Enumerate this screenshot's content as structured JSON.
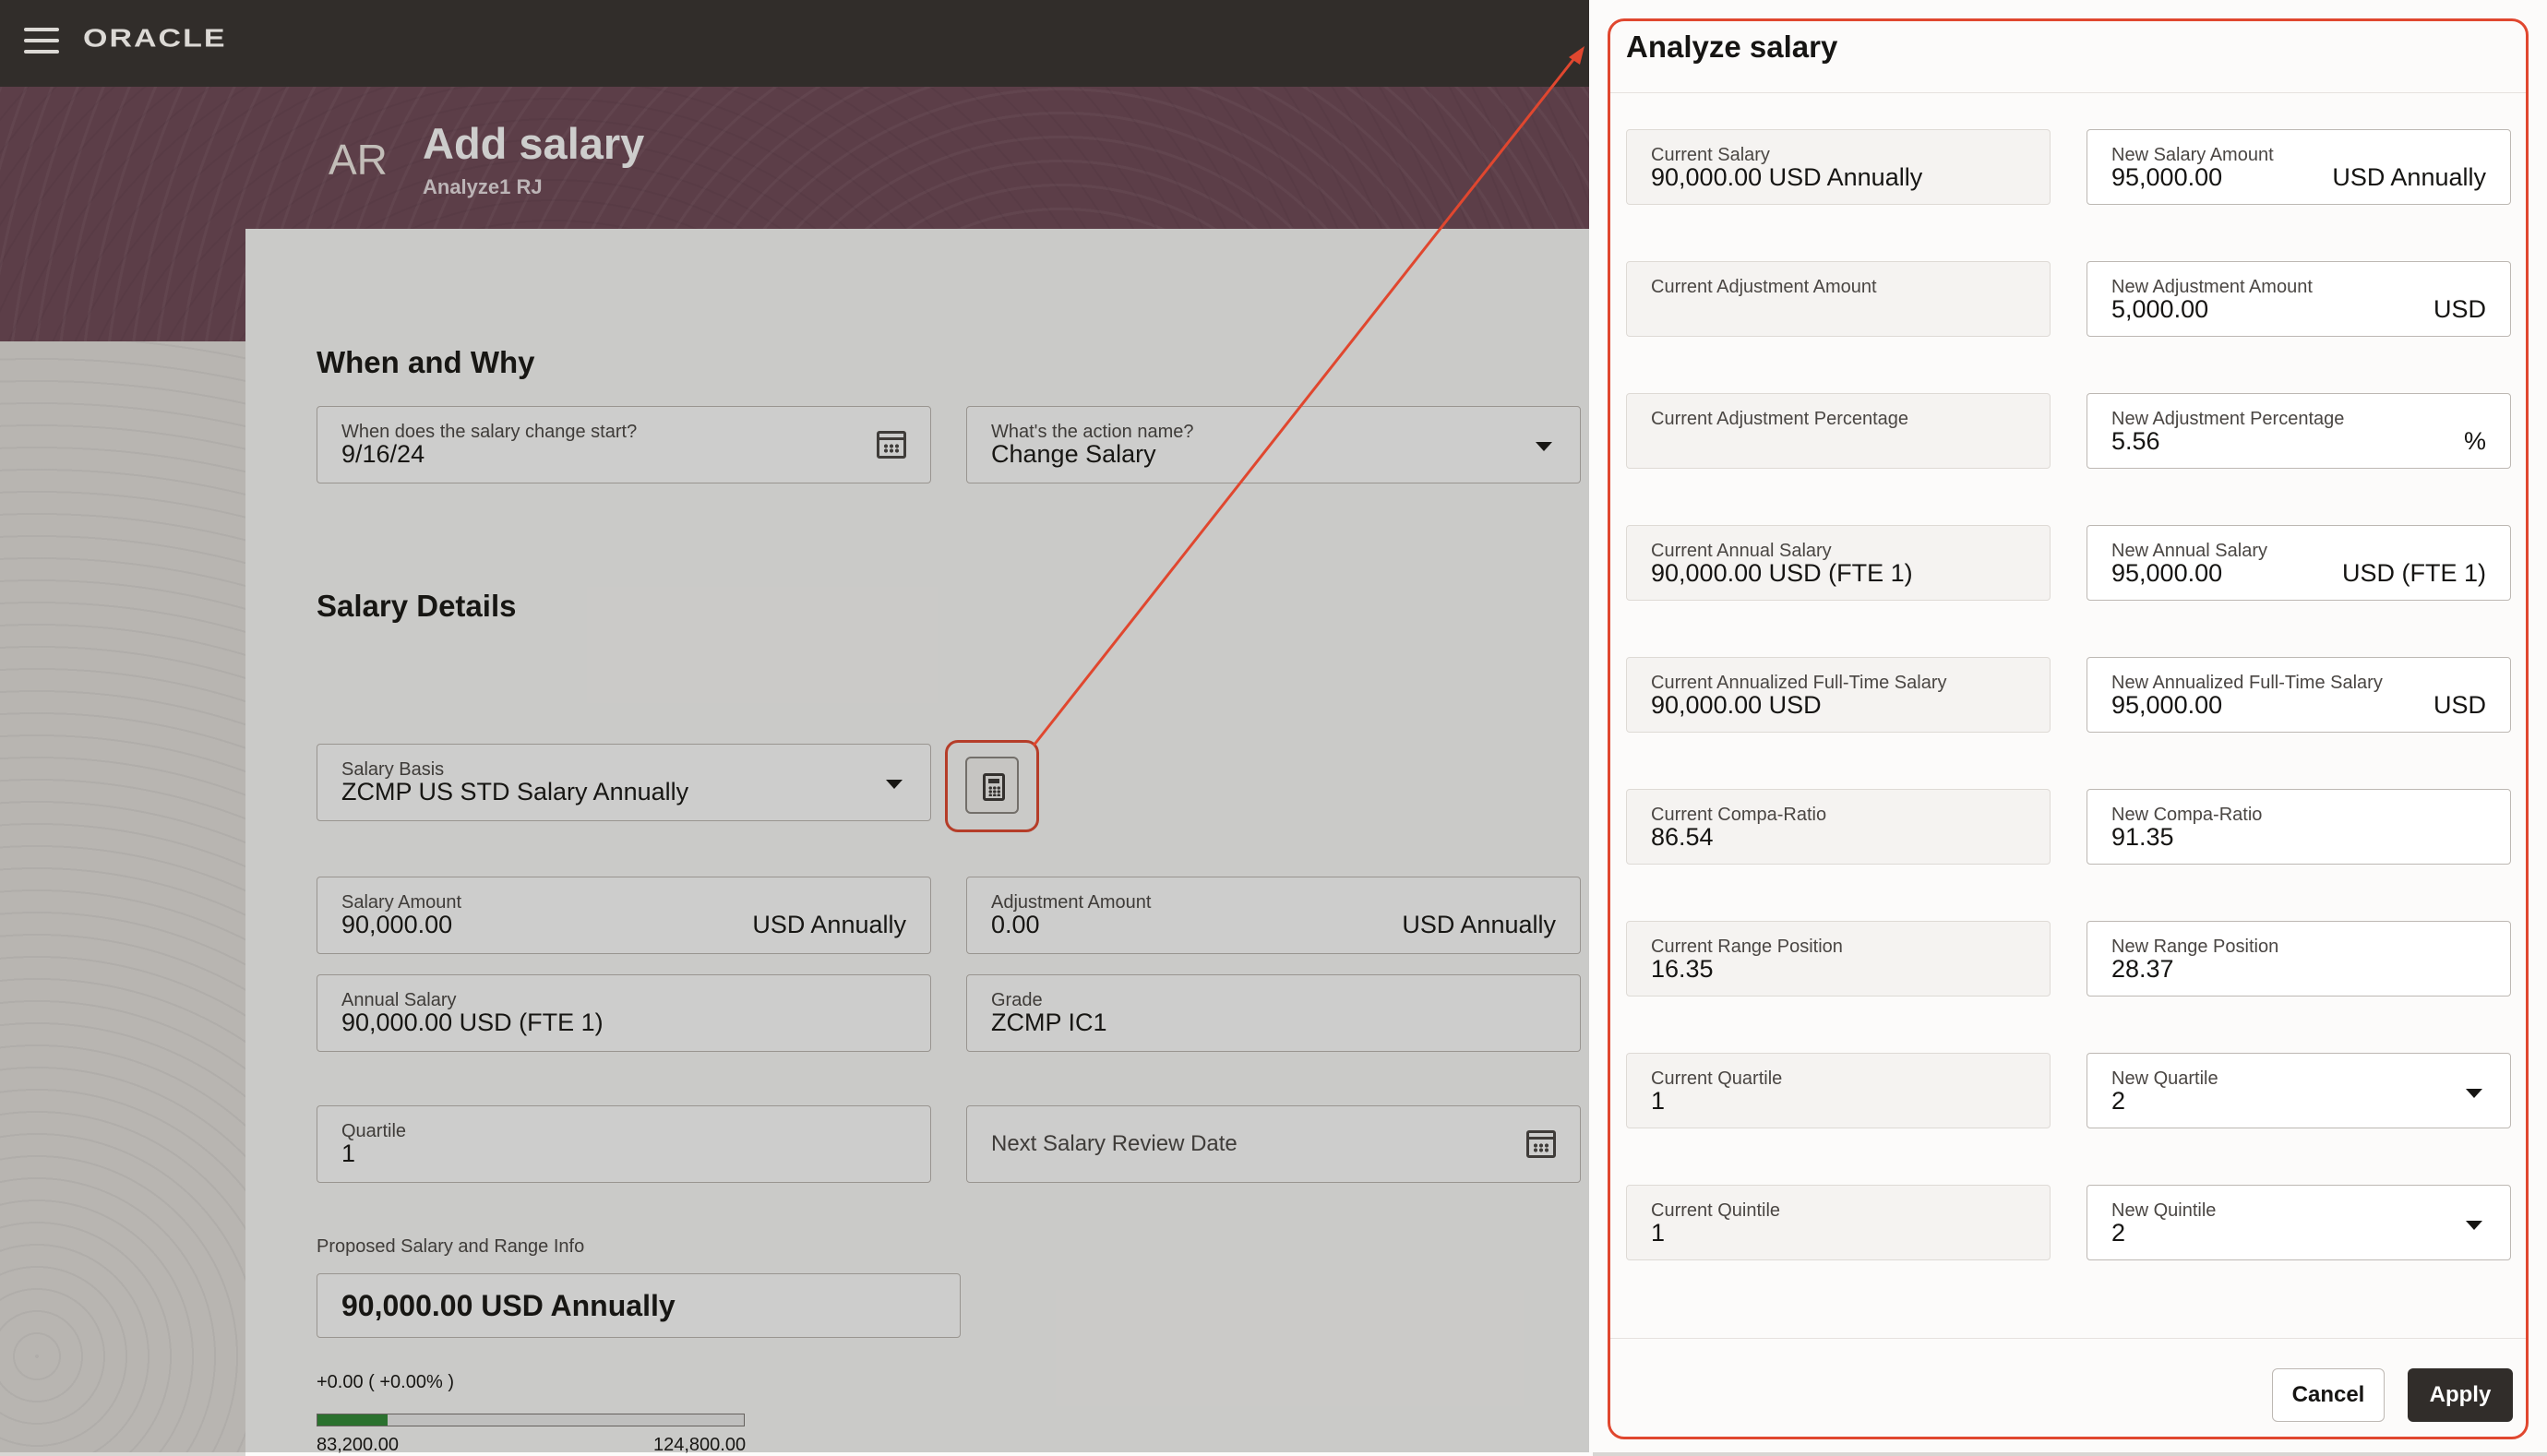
{
  "app": {
    "brand": "ORACLE"
  },
  "header": {
    "avatar_initials": "AR",
    "title": "Add salary",
    "subtitle": "Analyze1 RJ"
  },
  "when_why": {
    "title": "When and Why",
    "start_label": "When does the salary change start?",
    "start_value": "9/16/24",
    "action_label": "What's the action name?",
    "action_value": "Change Salary"
  },
  "salary_details": {
    "title": "Salary Details",
    "basis_label": "Salary Basis",
    "basis_value": "ZCMP US STD Salary Annually",
    "amount_label": "Salary Amount",
    "amount_value": "90,000.00",
    "amount_unit": "USD Annually",
    "adjustment_label": "Adjustment Amount",
    "adjustment_value": "0.00",
    "adjustment_unit": "USD Annually",
    "annual_label": "Annual Salary",
    "annual_value": "90,000.00 USD (FTE 1)",
    "grade_label": "Grade",
    "grade_value": "ZCMP IC1",
    "quartile_label": "Quartile",
    "quartile_value": "1",
    "review_placeholder": "Next Salary Review Date",
    "proposed_label": "Proposed Salary and Range Info",
    "proposed_value": "90,000.00 USD Annually",
    "delta": "+0.00 ( +0.00% )",
    "range_min": "83,200.00",
    "range_max": "124,800.00",
    "range_position_fraction": 0.1635
  },
  "drawer": {
    "title": "Analyze salary",
    "current": [
      {
        "label": "Current Salary",
        "value": "90,000.00 USD Annually"
      },
      {
        "label": "Current Adjustment Amount",
        "value": ""
      },
      {
        "label": "Current Adjustment Percentage",
        "value": ""
      },
      {
        "label": "Current Annual Salary",
        "value": "90,000.00 USD (FTE 1)"
      },
      {
        "label": "Current Annualized Full-Time Salary",
        "value": "90,000.00 USD"
      },
      {
        "label": "Current Compa-Ratio",
        "value": "86.54"
      },
      {
        "label": "Current Range Position",
        "value": "16.35"
      },
      {
        "label": "Current Quartile",
        "value": "1"
      },
      {
        "label": "Current Quintile",
        "value": "1"
      }
    ],
    "new": [
      {
        "label": "New Salary Amount",
        "value": "95,000.00",
        "unit": "USD Annually"
      },
      {
        "label": "New Adjustment Amount",
        "value": "5,000.00",
        "unit": "USD"
      },
      {
        "label": "New Adjustment Percentage",
        "value": "5.56",
        "unit": "%"
      },
      {
        "label": "New Annual Salary",
        "value": "95,000.00",
        "unit": "USD (FTE 1)"
      },
      {
        "label": "New Annualized Full-Time Salary",
        "value": "95,000.00",
        "unit": "USD"
      },
      {
        "label": "New Compa-Ratio",
        "value": "91.35",
        "unit": ""
      },
      {
        "label": "New Range Position",
        "value": "28.37",
        "unit": ""
      },
      {
        "label": "New Quartile",
        "value": "2",
        "unit": ""
      },
      {
        "label": "New Quintile",
        "value": "2",
        "unit": ""
      }
    ],
    "cancel_label": "Cancel",
    "apply_label": "Apply"
  },
  "colors": {
    "accent_highlight": "#e0472f",
    "topbar": "#312d2a",
    "header_band": "#6f4856",
    "range_fill": "#2f8a35"
  }
}
